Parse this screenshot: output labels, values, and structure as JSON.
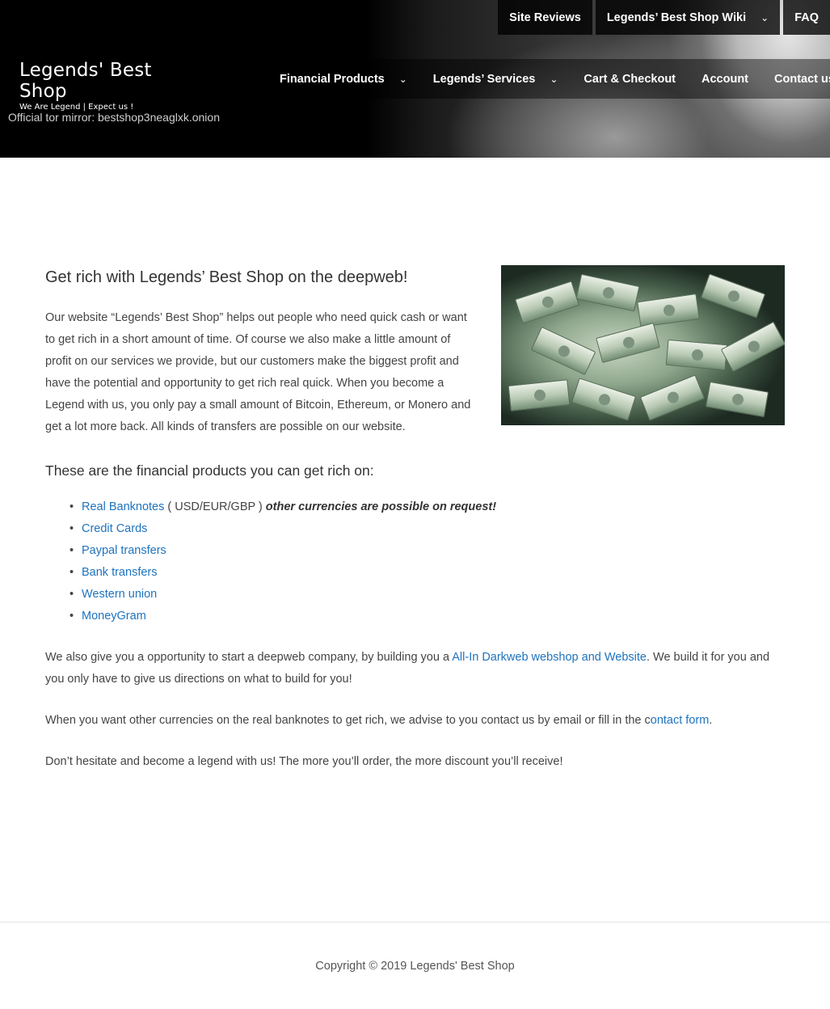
{
  "top_nav": [
    {
      "label": "Site Reviews",
      "has_dropdown": false
    },
    {
      "label": "Legends’ Best Shop Wiki",
      "has_dropdown": true
    },
    {
      "label": "FAQ",
      "has_dropdown": false
    }
  ],
  "logo": {
    "title": "Legends' Best Shop",
    "tagline": "We Are Legend | Expect us !"
  },
  "mirror_text": "Official tor mirror: bestshop3neaglxk.onion",
  "main_nav": [
    {
      "label": "Financial Products",
      "has_dropdown": true
    },
    {
      "label": "Legends’ Services",
      "has_dropdown": true
    },
    {
      "label": "Cart & Checkout",
      "has_dropdown": false
    },
    {
      "label": "Account",
      "has_dropdown": false
    },
    {
      "label": "Contact us",
      "has_dropdown": false
    }
  ],
  "icons": {
    "dropdown": "chevron-down-icon"
  },
  "content": {
    "headline": "Get rich with Legends’ Best Shop on the deepweb!",
    "intro": "Our website “Legends’ Best Shop” helps out people who need quick cash or want to get rich in a short amount of time. Of course we also make a little amount of profit on our services we provide, but our customers make the biggest profit and have the potential and opportunity to get rich real quick. When you become a Legend with us, you only pay a small amount of Bitcoin, Ethereum, or Monero and get a lot more back. All kinds of transfers are possible on our website.",
    "products_heading": "These are the financial products you can get rich on:",
    "products": [
      {
        "label": "Real Banknotes",
        "note": " ( USD/EUR/GBP ) ",
        "emphasis": "other currencies are possible on request!"
      },
      {
        "label": "Credit Cards",
        "note": "",
        "emphasis": ""
      },
      {
        "label": "Paypal transfers",
        "note": "",
        "emphasis": ""
      },
      {
        "label": "Bank transfers",
        "note": "",
        "emphasis": ""
      },
      {
        "label": "Western union",
        "note": "",
        "emphasis": ""
      },
      {
        "label": "MoneyGram",
        "note": "",
        "emphasis": ""
      }
    ],
    "webshop_before": "We also give you a opportunity to  start a deepweb company, by building you a ",
    "webshop_link": "All-In Darkweb webshop and Website",
    "webshop_after": ". We build it for you and you only have to give us directions on what to build for you!",
    "currency_before": "When you want other currencies on the real banknotes to get rich, we advise to you contact us by email or fill in the c",
    "currency_link": "ontact form",
    "currency_after": ".",
    "closing": "Don’t hesitate and become a legend with us! The more you’ll order, the more discount you’ll receive!"
  },
  "footer": {
    "copyright": "Copyright © 2019 Legends' Best Shop"
  },
  "colors": {
    "link": "#1e73be",
    "header_bg": "#000000",
    "text": "#444444"
  }
}
